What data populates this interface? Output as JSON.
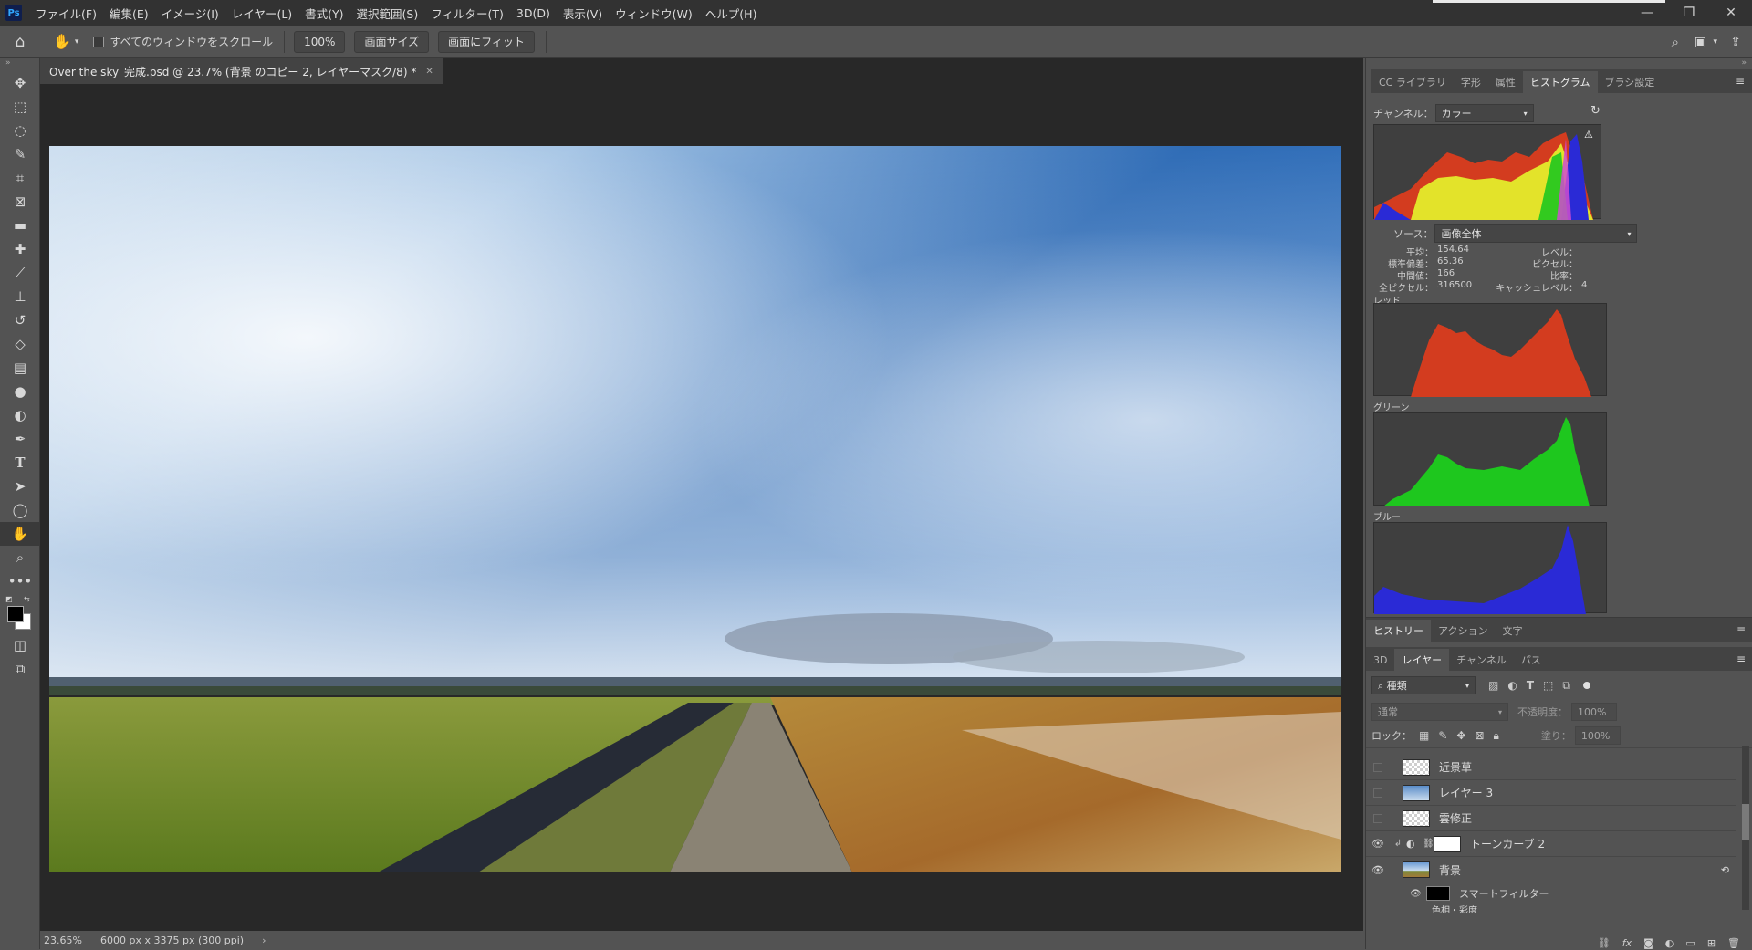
{
  "app": {
    "logo": "Ps"
  },
  "menu": [
    "ファイル(F)",
    "編集(E)",
    "イメージ(I)",
    "レイヤー(L)",
    "書式(Y)",
    "選択範囲(S)",
    "フィルター(T)",
    "3D(D)",
    "表示(V)",
    "ウィンドウ(W)",
    "ヘルプ(H)"
  ],
  "options": {
    "scroll_all_label": "すべてのウィンドウをスクロール",
    "zoom_button": "100%",
    "fit_screen_button": "画面サイズ",
    "fill_screen_button": "画面にフィット"
  },
  "document": {
    "tab_title": "Over the sky_完成.psd @ 23.7% (背景 のコピー 2, レイヤーマスク/8) *",
    "zoom": "23.65%",
    "dimensions": "6000 px x 3375 px (300 ppi)"
  },
  "top_panel": {
    "tabs": [
      "CC ライブラリ",
      "字形",
      "属性",
      "ヒストグラム",
      "ブラシ設定"
    ],
    "active_tab": "ヒストグラム"
  },
  "histogram": {
    "channel_label": "チャンネル：",
    "channel_value": "カラー",
    "source_label": "ソース：",
    "source_value": "画像全体",
    "stats_left": [
      {
        "label": "平均：",
        "value": "154.64"
      },
      {
        "label": "標準偏差：",
        "value": "65.36"
      },
      {
        "label": "中間値：",
        "value": "166"
      },
      {
        "label": "全ピクセル：",
        "value": "316500"
      }
    ],
    "stats_right": [
      {
        "label": "レベル：",
        "value": ""
      },
      {
        "label": "ピクセル：",
        "value": ""
      },
      {
        "label": "比率：",
        "value": ""
      },
      {
        "label": "キャッシュレベル：",
        "value": "4"
      }
    ],
    "channels": [
      "レッド",
      "グリーン",
      "ブルー"
    ],
    "colors": {
      "red": "#d33c1f",
      "green": "#1ec71e",
      "blue": "#2a2ad6",
      "yellow": "#e3e32a"
    }
  },
  "bottom_panel": {
    "tabs_row1": [
      "ヒストリー",
      "アクション",
      "文字"
    ],
    "tabs_row2": [
      "3D",
      "レイヤー",
      "チャンネル",
      "パス"
    ],
    "active_row2": "レイヤー",
    "filter_kind": "種類",
    "blend_mode": "通常",
    "opacity_label": "不透明度：",
    "opacity_value": "100%",
    "lock_label": "ロック：",
    "fill_label": "塗り：",
    "fill_value": "100%",
    "layers": [
      {
        "name": "近景草",
        "visible": false,
        "thumb": "checker"
      },
      {
        "name": "レイヤー 3",
        "visible": false,
        "thumb": "sky"
      },
      {
        "name": "雲修正",
        "visible": false,
        "thumb": "checker"
      },
      {
        "name": "トーンカーブ 2",
        "visible": true,
        "thumb": "adjust"
      },
      {
        "name": "背景",
        "visible": true,
        "thumb": "photo"
      }
    ],
    "smart_filter_label": "スマートフィルター",
    "sub_filter_label": "色相・彩度"
  }
}
